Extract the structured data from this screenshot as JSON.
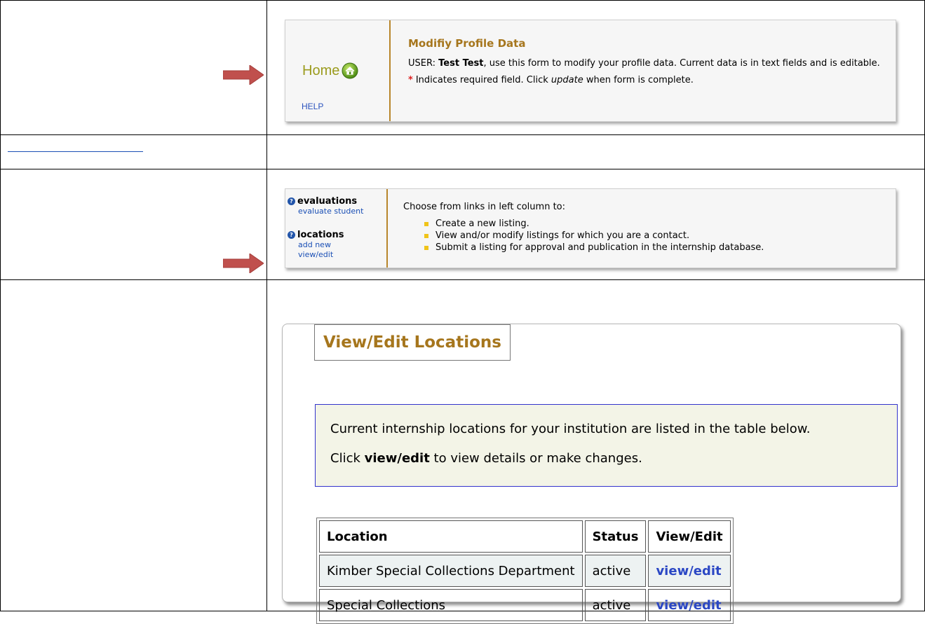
{
  "profile_panel": {
    "home_label": "Home",
    "help_label": "HELP",
    "title": "Modifiy Profile Data",
    "user_prefix": "USER: ",
    "user_name": "Test Test",
    "intro_rest": ", use this form to modify your profile data. Current data is in text fields and is editable.",
    "required_star": "*",
    "required_pre": "Indicates required field. Click ",
    "required_em": "update",
    "required_post": " when form is complete."
  },
  "nav_panel": {
    "sections": [
      {
        "label": "evaluations",
        "links": [
          "evaluate student"
        ]
      },
      {
        "label": "locations",
        "links": [
          "add new",
          "view/edit"
        ]
      }
    ],
    "intro": "Choose from links in left column to:",
    "bullets": [
      "Create a new listing.",
      "View and/or modify listings for which you are a contact.",
      "Submit a listing for approval and publication in the internship database."
    ]
  },
  "locations_panel": {
    "legend": "View/Edit Locations",
    "info_line1": "Current internship locations for your institution are listed in the table below.",
    "info_line2_pre": "Click ",
    "info_line2_bold": "view/edit",
    "info_line2_post": " to view details or make changes.",
    "table": {
      "headers": [
        "Location",
        "Status",
        "View/Edit"
      ],
      "rows": [
        {
          "location": "Kimber Special Collections Department",
          "status": "active",
          "action": "view/edit"
        },
        {
          "location": "Special Collections",
          "status": "active",
          "action": "view/edit"
        }
      ]
    }
  },
  "colors": {
    "accent_gold": "#a6761d",
    "arrow": "#c0504d",
    "link_blue": "#2b47c4"
  }
}
